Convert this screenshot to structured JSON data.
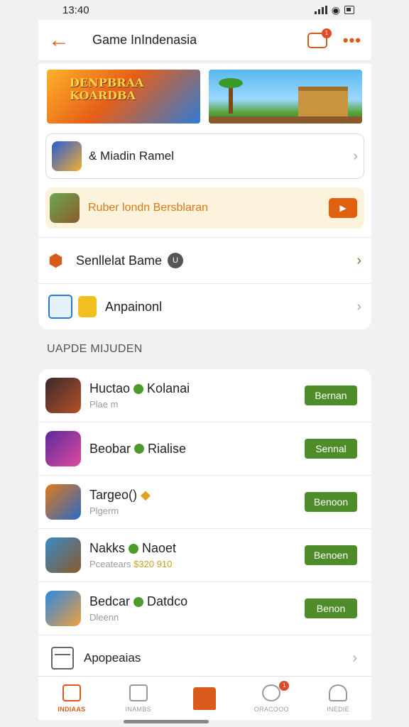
{
  "status_bar": {
    "time": "13:40"
  },
  "header": {
    "title": "Game InIndenasia",
    "notification_count": "1"
  },
  "banners": [
    {
      "logo_text": "DENPBRAA KOARDBA"
    },
    {
      "logo_text": ""
    }
  ],
  "feature_row": {
    "label": "& Miadin Ramel"
  },
  "promo": {
    "label": "Ruber londn Bersblaran"
  },
  "menu": [
    {
      "label": "Senllelat Bame",
      "badge": "U"
    },
    {
      "label": "Anpainonl"
    }
  ],
  "section": {
    "title": "UAPDE MIJUDEN"
  },
  "games": [
    {
      "name": "Huctao",
      "name2": "Kolanai",
      "sub": "Plae m",
      "button": "Bernan",
      "icon_colors": [
        "#3a2a2a",
        "#b4512a"
      ]
    },
    {
      "name": "Beobar",
      "name2": "Rialise",
      "sub": "",
      "button": "Sennal",
      "icon_colors": [
        "#5a2a9a",
        "#e04aa0"
      ]
    },
    {
      "name": "Targeo()",
      "name2": "",
      "sub": "Plgerm",
      "button": "Benoon",
      "icon_colors": [
        "#e07a1a",
        "#2a6ac8"
      ]
    },
    {
      "name": "Nakks",
      "name2": "Naoet",
      "sub": "Pceatears",
      "price": "$320 910",
      "button": "Benoen",
      "icon_colors": [
        "#3a8ac8",
        "#8a5a2a"
      ]
    },
    {
      "name": "Bedcar",
      "name2": "Datdco",
      "sub": "Dleenn",
      "button": "Benon",
      "icon_colors": [
        "#2a8ae0",
        "#f0a040"
      ]
    }
  ],
  "more_row": {
    "label": "Apopeaias"
  },
  "tabs": [
    {
      "label": "INDIAAS",
      "active": true
    },
    {
      "label": "INAMBS",
      "active": false
    },
    {
      "label": "",
      "active": false
    },
    {
      "label": "ORACOOO",
      "active": false,
      "badge": "1"
    },
    {
      "label": "INEDIE",
      "active": false
    }
  ]
}
